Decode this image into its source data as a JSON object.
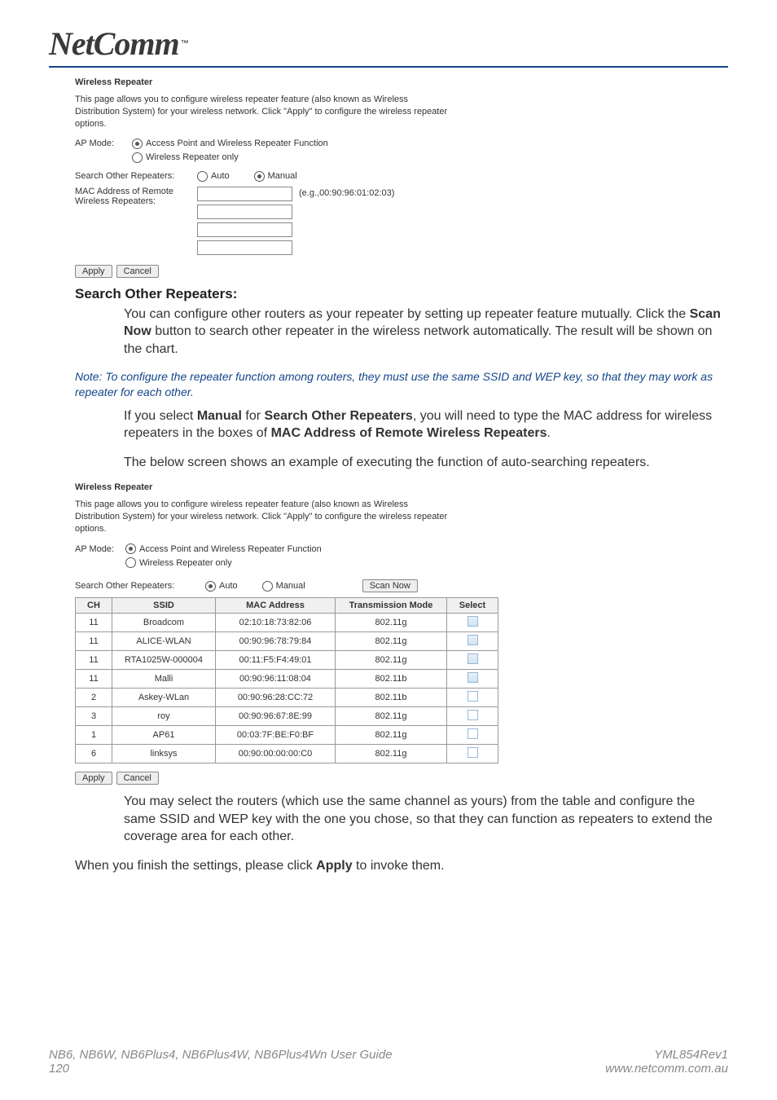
{
  "logo": {
    "brand": "NetComm",
    "tm": "™"
  },
  "shot1": {
    "title": "Wireless Repeater",
    "desc": "This page allows you to configure wireless repeater feature (also known as Wireless Distribution System) for your wireless network. Click \"Apply\" to configure the wireless repeater options.",
    "ap_mode_label": "AP Mode:",
    "ap_opt1": "Access Point and Wireless Repeater Function",
    "ap_opt2": "Wireless Repeater only",
    "search_label": "Search Other Repeaters:",
    "auto": "Auto",
    "manual": "Manual",
    "mac_label": "MAC Address of Remote Wireless Repeaters:",
    "mac_hint": "(e.g.,00:90:96:01:02:03)",
    "apply": "Apply",
    "cancel": "Cancel"
  },
  "heading1": "Search Other Repeaters:",
  "para1_a": "You can configure other routers as your repeater by setting up repeater feature mutually. Click the ",
  "para1_b": "Scan Now",
  "para1_c": " button to search other repeater in the wireless network automatically. The result will be shown on the chart.",
  "note": "Note:  To configure the repeater function among routers, they must use the same SSID and WEP key, so that they may work as repeater for each other.",
  "para2_a": "If you select ",
  "para2_b": "Manual",
  "para2_c": " for ",
  "para2_d": "Search Other Repeaters",
  "para2_e": ", you will need to type the MAC address for wireless repeaters in the boxes of ",
  "para2_f": "MAC Address of Remote Wireless Repeaters",
  "para2_g": ".",
  "para3": "The below screen shows an example of executing the function of auto-searching repeaters.",
  "shot2": {
    "title": "Wireless Repeater",
    "desc": "This page allows you to configure wireless repeater feature (also known as Wireless Distribution System) for your wireless network. Click \"Apply\" to configure the wireless repeater options.",
    "ap_mode_label": "AP Mode:",
    "ap_opt1": "Access Point and Wireless Repeater Function",
    "ap_opt2": "Wireless Repeater only",
    "search_label": "Search Other Repeaters:",
    "auto": "Auto",
    "manual": "Manual",
    "scan_now": "Scan Now",
    "headers": {
      "ch": "CH",
      "ssid": "SSID",
      "mac": "MAC Address",
      "mode": "Transmission Mode",
      "select": "Select"
    },
    "rows": [
      {
        "ch": "11",
        "ssid": "Broadcom",
        "mac": "02:10:18:73:82:06",
        "mode": "802.11g",
        "sel": true
      },
      {
        "ch": "11",
        "ssid": "ALICE-WLAN",
        "mac": "00:90:96:78:79:84",
        "mode": "802.11g",
        "sel": true
      },
      {
        "ch": "11",
        "ssid": "RTA1025W-000004",
        "mac": "00:11:F5:F4:49:01",
        "mode": "802.11g",
        "sel": true
      },
      {
        "ch": "11",
        "ssid": "Malli",
        "mac": "00:90:96:11:08:04",
        "mode": "802.11b",
        "sel": true
      },
      {
        "ch": "2",
        "ssid": "Askey-WLan",
        "mac": "00:90:96:28:CC:72",
        "mode": "802.11b",
        "sel": false
      },
      {
        "ch": "3",
        "ssid": "roy",
        "mac": "00:90:96:67:8E:99",
        "mode": "802.11g",
        "sel": false
      },
      {
        "ch": "1",
        "ssid": "AP61",
        "mac": "00:03:7F:BE:F0:BF",
        "mode": "802.11g",
        "sel": false
      },
      {
        "ch": "6",
        "ssid": "linksys",
        "mac": "00:90:00:00:00:C0",
        "mode": "802.11g",
        "sel": false
      }
    ],
    "apply": "Apply",
    "cancel": "Cancel"
  },
  "para4": "You may select the routers (which use the same channel as yours) from the table and configure the same SSID and WEP key with the one you chose, so that they can function as repeaters to extend the coverage area for each other.",
  "para5_a": "When you finish the settings, please click ",
  "para5_b": "Apply",
  "para5_c": " to invoke them.",
  "footer": {
    "left1": "NB6, NB6W, NB6Plus4, NB6Plus4W, NB6Plus4Wn User Guide",
    "left2": "120",
    "right1": "YML854Rev1",
    "right2": "www.netcomm.com.au"
  }
}
